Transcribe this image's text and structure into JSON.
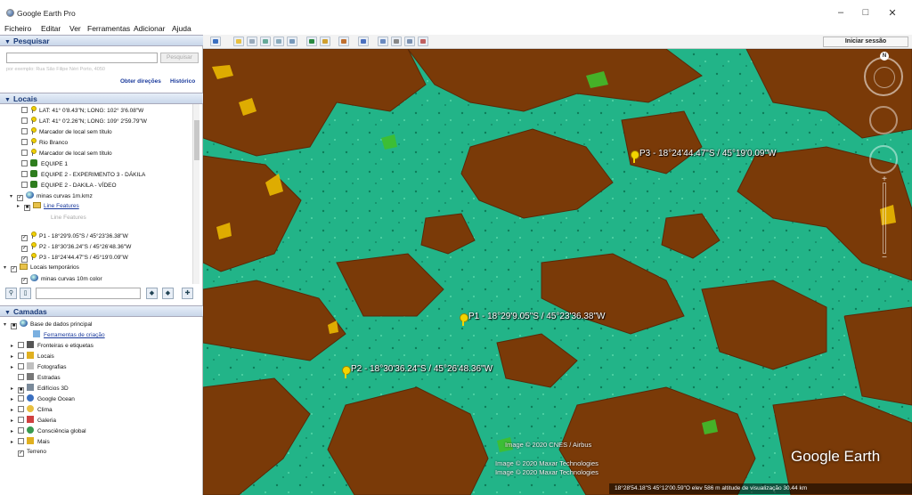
{
  "window": {
    "title": "Google Earth Pro",
    "minimize": "–",
    "maximize": "□",
    "close": "✕"
  },
  "menu": [
    "Ficheiro",
    "Editar",
    "Ver",
    "Ferramentas",
    "Adicionar",
    "Ajuda"
  ],
  "search": {
    "header": "Pesquisar",
    "placeholder": "",
    "button": "Pesquisar",
    "hint": "por exemplo: Rua São Filipe Néri Porto, 4050",
    "directions_link": "Obter direções",
    "history_link": "Histórico"
  },
  "places": {
    "header": "Locais",
    "items": [
      {
        "label": "LAT:  41° 0'8.43\"N; LONG: 102° 3'6.08\"W",
        "checked": false,
        "icon": "placemark-pin-icon"
      },
      {
        "label": "LAT:  41° 0'2.26\"N; LONG: 109° 2'59.79\"W",
        "checked": false,
        "icon": "placemark-pin-icon"
      },
      {
        "label": "Marcador de local sem título",
        "checked": false,
        "icon": "placemark-pin-icon"
      },
      {
        "label": "Rio Branco",
        "checked": false,
        "icon": "placemark-pin-icon"
      },
      {
        "label": "Marcador de local sem título",
        "checked": false,
        "icon": "placemark-pin-icon"
      },
      {
        "label": "EQUIPE 1",
        "checked": false,
        "icon": "photo-overlay-icon"
      },
      {
        "label": "EQUIPE 2 - EXPERIMENTO 3 - DÁKILA",
        "checked": false,
        "icon": "photo-overlay-icon"
      },
      {
        "label": "EQUIPE 2 - DAKILA - VÍDEO",
        "checked": false,
        "icon": "photo-overlay-icon"
      }
    ],
    "kmz": {
      "label": "minas curvas 1m.kmz",
      "checked": true
    },
    "line_features_link": "Line Features",
    "line_features_grey": "Line Features",
    "points": [
      {
        "label": "P1 -  18°29'9.05\"S /  45°23'36.38\"W",
        "checked": true
      },
      {
        "label": "P2 -  18°30'36.24\"S /  45°26'48.36\"W",
        "checked": true
      },
      {
        "label": "P3 - 18°24'44.47\"S / 45°19'0.09\"W",
        "checked": true
      }
    ],
    "temporary": {
      "label": "Locais temporários",
      "checked": true
    },
    "temp_child": {
      "label": "minas curvas 10m color",
      "checked": true
    }
  },
  "layers": {
    "header": "Camadas",
    "primary_db": "Base de dados principal",
    "tools_link": "Ferramentas de criação",
    "items": [
      {
        "label": "Fronteiras e etiquetas",
        "icon": "borders-icon",
        "color": "#555555"
      },
      {
        "label": "Locais",
        "icon": "places-layer-icon",
        "color": "#e0b020"
      },
      {
        "label": "Fotografias",
        "icon": "photos-icon",
        "color": "#c0c0c0"
      },
      {
        "label": "Estradas",
        "icon": "roads-icon",
        "color": "#777777"
      },
      {
        "label": "Edifícios 3D",
        "icon": "buildings-3d-icon",
        "color": "#7a8a9a"
      },
      {
        "label": "Google Ocean",
        "icon": "ocean-icon",
        "color": "#3a6fc0"
      },
      {
        "label": "Clima",
        "icon": "weather-icon",
        "color": "#e8c040"
      },
      {
        "label": "Galeria",
        "icon": "gallery-icon",
        "color": "#d04040"
      },
      {
        "label": "Consciência global",
        "icon": "global-awareness-icon",
        "color": "#3a9a50"
      },
      {
        "label": "Mais",
        "icon": "more-icon",
        "color": "#e0b020"
      }
    ],
    "terrain": "Terreno"
  },
  "toolbar": {
    "signin": "Iniciar sessão"
  },
  "map": {
    "placemarks": [
      {
        "name": "P1",
        "label": "P1 -  18°29'9.05\"S /  45°23'36.38\"W"
      },
      {
        "name": "P2",
        "label": "P2 -  18°30'36.24\"S /  45°26'48.36\"W"
      },
      {
        "name": "P3",
        "label": "P3 - 18°24'44.47\"S / 45°19'0.09\"W"
      }
    ],
    "credits": [
      "Image © 2020 CNES / Airbus",
      "Image © 2020 Maxar Technologies",
      "Image © 2020 Maxar Technologies"
    ],
    "logo": "Google Earth",
    "compass_north": "N",
    "status": "18°28'54.18\"S  45°12'00.59\"O  elev  586 m     altitude de visualização  30.44 km"
  }
}
